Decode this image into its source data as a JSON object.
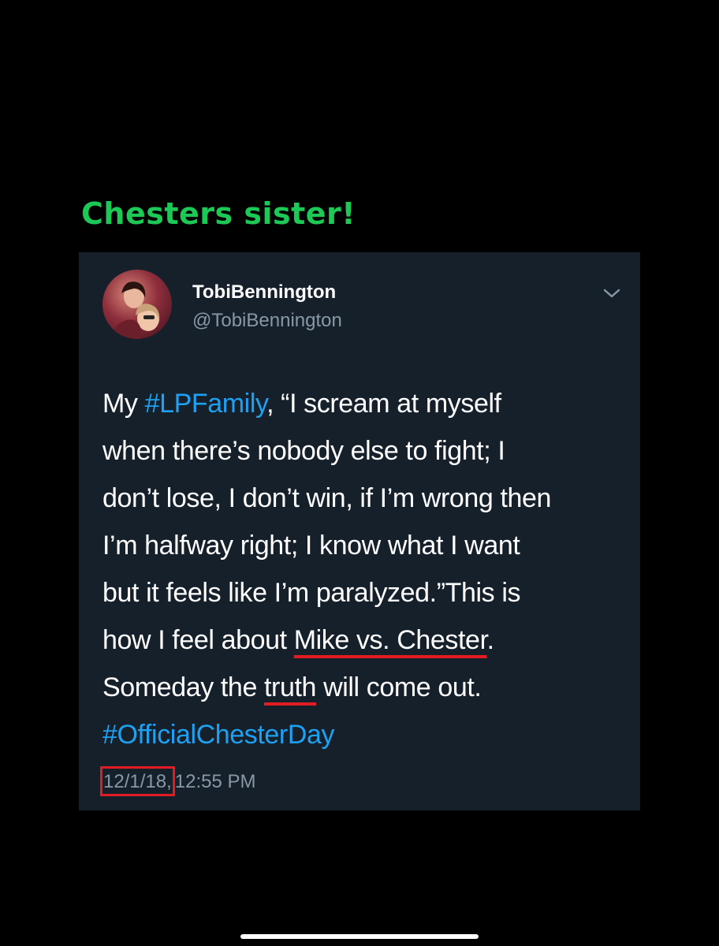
{
  "caption": "Chesters sister!",
  "tweet": {
    "display_name": "TobiBennington",
    "handle": "@TobiBennington",
    "menu_icon": "chevron-down-icon",
    "lines": [
      {
        "pre": "My ",
        "tag": "#LPFamily",
        "post": ", “I scream at myself"
      },
      "when there’s nobody else to fight; I",
      "don’t lose, I don’t win, if I’m wrong then",
      "I’m halfway right; I know what I want",
      "but it feels like I’m paralyzed.”This is",
      {
        "pre": "how I feel about ",
        "underlined": "Mike vs. Chester",
        "post": "."
      },
      {
        "pre": "Someday the ",
        "underlined": "truth",
        "post": " will come out."
      },
      {
        "tag": "#OfficialChesterDay"
      }
    ],
    "date": "12/1/18,",
    "time": "12:55 PM"
  },
  "colors": {
    "caption": "#1dc956",
    "card_background": "#15202b",
    "hashtag": "#1da1f2",
    "secondary_text": "#8899a6",
    "annotation": "#e31b23"
  }
}
